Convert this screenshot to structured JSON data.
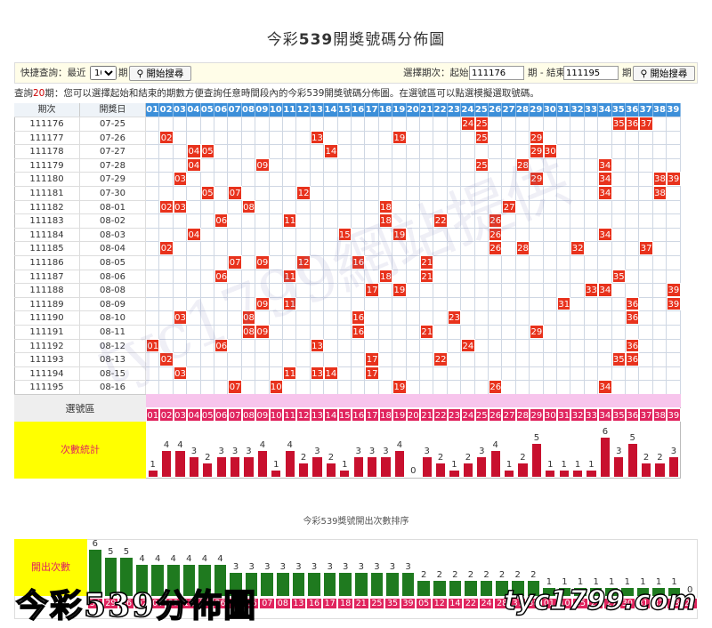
{
  "title_prefix": "今彩",
  "title_num": "539",
  "title_suffix": "開獎號碼分佈圖",
  "controls": {
    "quick_label": "快捷查詢：最近",
    "quick_value": "10",
    "period_unit": "期",
    "search_button": "開始搜尋",
    "select_label": "選擇期次：起始",
    "start_value": "111176",
    "end_label": "期 - 結束",
    "end_value": "111195",
    "end_unit": "期",
    "search_button2": "開始搜尋"
  },
  "info": {
    "prefix": "查詢",
    "count": "20",
    "suffix": "期：您可以選擇起始和結束的期數方便查詢任意時間段內的今彩539開獎號碼分佈圖。在選號區可以點選模擬選取號碼。"
  },
  "table": {
    "header_period": "期次",
    "header_date": "開獎日",
    "numbers": [
      "01",
      "02",
      "03",
      "04",
      "05",
      "06",
      "07",
      "08",
      "09",
      "10",
      "11",
      "12",
      "13",
      "14",
      "15",
      "16",
      "17",
      "18",
      "19",
      "20",
      "21",
      "22",
      "23",
      "24",
      "25",
      "26",
      "27",
      "28",
      "29",
      "30",
      "31",
      "32",
      "33",
      "34",
      "35",
      "36",
      "37",
      "38",
      "39"
    ],
    "rows": [
      {
        "period": "111176",
        "date": "07-25",
        "nums": [
          24,
          25,
          35,
          36,
          37
        ]
      },
      {
        "period": "111177",
        "date": "07-26",
        "nums": [
          2,
          13,
          19,
          25,
          29
        ]
      },
      {
        "period": "111178",
        "date": "07-27",
        "nums": [
          4,
          5,
          14,
          29,
          30
        ]
      },
      {
        "period": "111179",
        "date": "07-28",
        "nums": [
          4,
          9,
          25,
          28,
          34
        ]
      },
      {
        "period": "111180",
        "date": "07-29",
        "nums": [
          3,
          29,
          34,
          38,
          39
        ]
      },
      {
        "period": "111181",
        "date": "07-30",
        "nums": [
          5,
          7,
          12,
          34,
          38
        ]
      },
      {
        "period": "111182",
        "date": "08-01",
        "nums": [
          2,
          3,
          8,
          18,
          27
        ]
      },
      {
        "period": "111183",
        "date": "08-02",
        "nums": [
          6,
          11,
          18,
          22,
          26
        ]
      },
      {
        "period": "111184",
        "date": "08-03",
        "nums": [
          4,
          15,
          19,
          26,
          34
        ]
      },
      {
        "period": "111185",
        "date": "08-04",
        "nums": [
          2,
          26,
          28,
          32,
          37
        ]
      },
      {
        "period": "111186",
        "date": "08-05",
        "nums": [
          7,
          9,
          12,
          16,
          21
        ]
      },
      {
        "period": "111187",
        "date": "08-06",
        "nums": [
          6,
          11,
          18,
          21,
          35
        ]
      },
      {
        "period": "111188",
        "date": "08-08",
        "nums": [
          17,
          19,
          33,
          34,
          39
        ]
      },
      {
        "period": "111189",
        "date": "08-09",
        "nums": [
          9,
          11,
          31,
          36,
          39
        ]
      },
      {
        "period": "111190",
        "date": "08-10",
        "nums": [
          3,
          8,
          16,
          23,
          36
        ]
      },
      {
        "period": "111191",
        "date": "08-11",
        "nums": [
          8,
          9,
          16,
          21,
          29
        ]
      },
      {
        "period": "111192",
        "date": "08-12",
        "nums": [
          1,
          6,
          13,
          24,
          36
        ]
      },
      {
        "period": "111193",
        "date": "08-13",
        "nums": [
          2,
          17,
          22,
          35,
          36
        ]
      },
      {
        "period": "111194",
        "date": "08-15",
        "nums": [
          3,
          11,
          13,
          14,
          17
        ]
      },
      {
        "period": "111195",
        "date": "08-16",
        "nums": [
          7,
          10,
          19,
          26,
          34
        ]
      }
    ],
    "pick_label": "選號區",
    "count_label": "次數統計",
    "counts": [
      1,
      4,
      4,
      3,
      2,
      3,
      3,
      3,
      4,
      1,
      4,
      2,
      3,
      2,
      1,
      3,
      3,
      3,
      4,
      0,
      3,
      2,
      1,
      2,
      3,
      4,
      1,
      2,
      5,
      1,
      1,
      1,
      1,
      6,
      3,
      5,
      2,
      2,
      3
    ]
  },
  "ranking": {
    "title": "今彩539獎號開出次數排序",
    "label": "開出次數",
    "values": [
      6,
      5,
      5,
      4,
      4,
      4,
      4,
      4,
      4,
      3,
      3,
      3,
      3,
      3,
      3,
      3,
      3,
      3,
      3,
      3,
      3,
      2,
      2,
      2,
      2,
      2,
      2,
      2,
      2,
      1,
      1,
      1,
      1,
      1,
      1,
      1,
      1,
      1,
      0
    ],
    "numbers": [
      "34",
      "29",
      "36",
      "02",
      "03",
      "09",
      "11",
      "19",
      "26",
      "04",
      "06",
      "07",
      "08",
      "13",
      "16",
      "17",
      "18",
      "21",
      "25",
      "35",
      "39",
      "05",
      "12",
      "14",
      "22",
      "24",
      "28",
      "37",
      "38",
      "01",
      "10",
      "15",
      "23",
      "27",
      "30",
      "31",
      "32",
      "33",
      "20"
    ]
  },
  "brand": {
    "left": "今彩539分佈圖",
    "right": "tyc1799.com",
    "watermark": "tyc1799網站提供"
  },
  "colors": {
    "hit": "#e8321c",
    "header_blue": "#3c8fd9",
    "pink_row": "#f7c4ec",
    "count_bar": "#c8102e",
    "green_bar": "#1f7a1f",
    "yellow": "#ffff00",
    "red_label": "#e0245e"
  }
}
